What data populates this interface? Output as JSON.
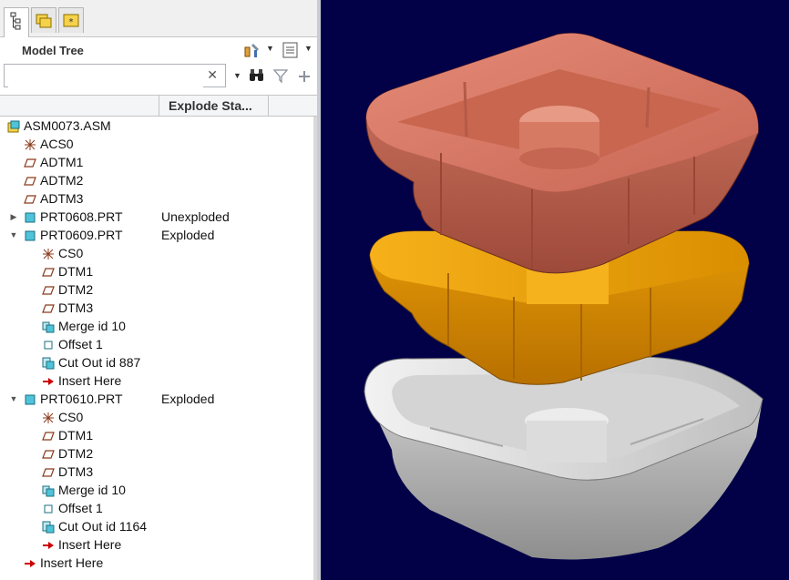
{
  "panel": {
    "title": "Model Tree",
    "search_placeholder": "",
    "column_header": "Explode Sta..."
  },
  "tree": [
    {
      "label": "ASM0073.ASM",
      "icon": "assembly-icon",
      "indent": 0,
      "toggle": "",
      "state": ""
    },
    {
      "label": "ACS0",
      "icon": "csys-icon",
      "indent": 1,
      "toggle": "",
      "state": ""
    },
    {
      "label": "ADTM1",
      "icon": "datum-plane-icon",
      "indent": 1,
      "toggle": "",
      "state": ""
    },
    {
      "label": "ADTM2",
      "icon": "datum-plane-icon",
      "indent": 1,
      "toggle": "",
      "state": ""
    },
    {
      "label": "ADTM3",
      "icon": "datum-plane-icon",
      "indent": 1,
      "toggle": "",
      "state": ""
    },
    {
      "label": "PRT0608.PRT",
      "icon": "part-icon",
      "indent": 1,
      "toggle": "collapsed",
      "state": "Unexploded"
    },
    {
      "label": "PRT0609.PRT",
      "icon": "part-icon",
      "indent": 1,
      "toggle": "expanded",
      "state": "Exploded"
    },
    {
      "label": "CS0",
      "icon": "csys-icon",
      "indent": 2,
      "toggle": "",
      "state": ""
    },
    {
      "label": "DTM1",
      "icon": "datum-plane-icon",
      "indent": 2,
      "toggle": "",
      "state": ""
    },
    {
      "label": "DTM2",
      "icon": "datum-plane-icon",
      "indent": 2,
      "toggle": "",
      "state": ""
    },
    {
      "label": "DTM3",
      "icon": "datum-plane-icon",
      "indent": 2,
      "toggle": "",
      "state": ""
    },
    {
      "label": "Merge id 10",
      "icon": "merge-icon",
      "indent": 2,
      "toggle": "",
      "state": ""
    },
    {
      "label": "Offset 1",
      "icon": "offset-icon",
      "indent": 2,
      "toggle": "",
      "state": ""
    },
    {
      "label": "Cut Out id 887",
      "icon": "cutout-icon",
      "indent": 2,
      "toggle": "",
      "state": ""
    },
    {
      "label": "Insert Here",
      "icon": "insert-arrow-icon",
      "indent": 2,
      "toggle": "",
      "state": ""
    },
    {
      "label": "PRT0610.PRT",
      "icon": "part-icon",
      "indent": 1,
      "toggle": "expanded",
      "state": "Exploded"
    },
    {
      "label": "CS0",
      "icon": "csys-icon",
      "indent": 2,
      "toggle": "",
      "state": ""
    },
    {
      "label": "DTM1",
      "icon": "datum-plane-icon",
      "indent": 2,
      "toggle": "",
      "state": ""
    },
    {
      "label": "DTM2",
      "icon": "datum-plane-icon",
      "indent": 2,
      "toggle": "",
      "state": ""
    },
    {
      "label": "DTM3",
      "icon": "datum-plane-icon",
      "indent": 2,
      "toggle": "",
      "state": ""
    },
    {
      "label": "Merge id 10",
      "icon": "merge-icon",
      "indent": 2,
      "toggle": "",
      "state": ""
    },
    {
      "label": "Offset 1",
      "icon": "offset-icon",
      "indent": 2,
      "toggle": "",
      "state": ""
    },
    {
      "label": "Cut Out id 1164",
      "icon": "cutout-icon",
      "indent": 2,
      "toggle": "",
      "state": ""
    },
    {
      "label": "Insert Here",
      "icon": "insert-arrow-icon",
      "indent": 2,
      "toggle": "",
      "state": ""
    },
    {
      "label": "Insert Here",
      "icon": "insert-arrow-icon",
      "indent": 1,
      "toggle": "",
      "state": ""
    }
  ],
  "viewport": {
    "background": "#020147",
    "parts": [
      {
        "name": "top-part",
        "color": "#d9735f"
      },
      {
        "name": "middle-part",
        "color": "#e8a010"
      },
      {
        "name": "bottom-part",
        "color": "#c8c8c8"
      }
    ]
  },
  "colors": {
    "toggle_gray": "#555555",
    "insert_arrow": "#cc0000",
    "part_icon": "#4fc3d9"
  }
}
